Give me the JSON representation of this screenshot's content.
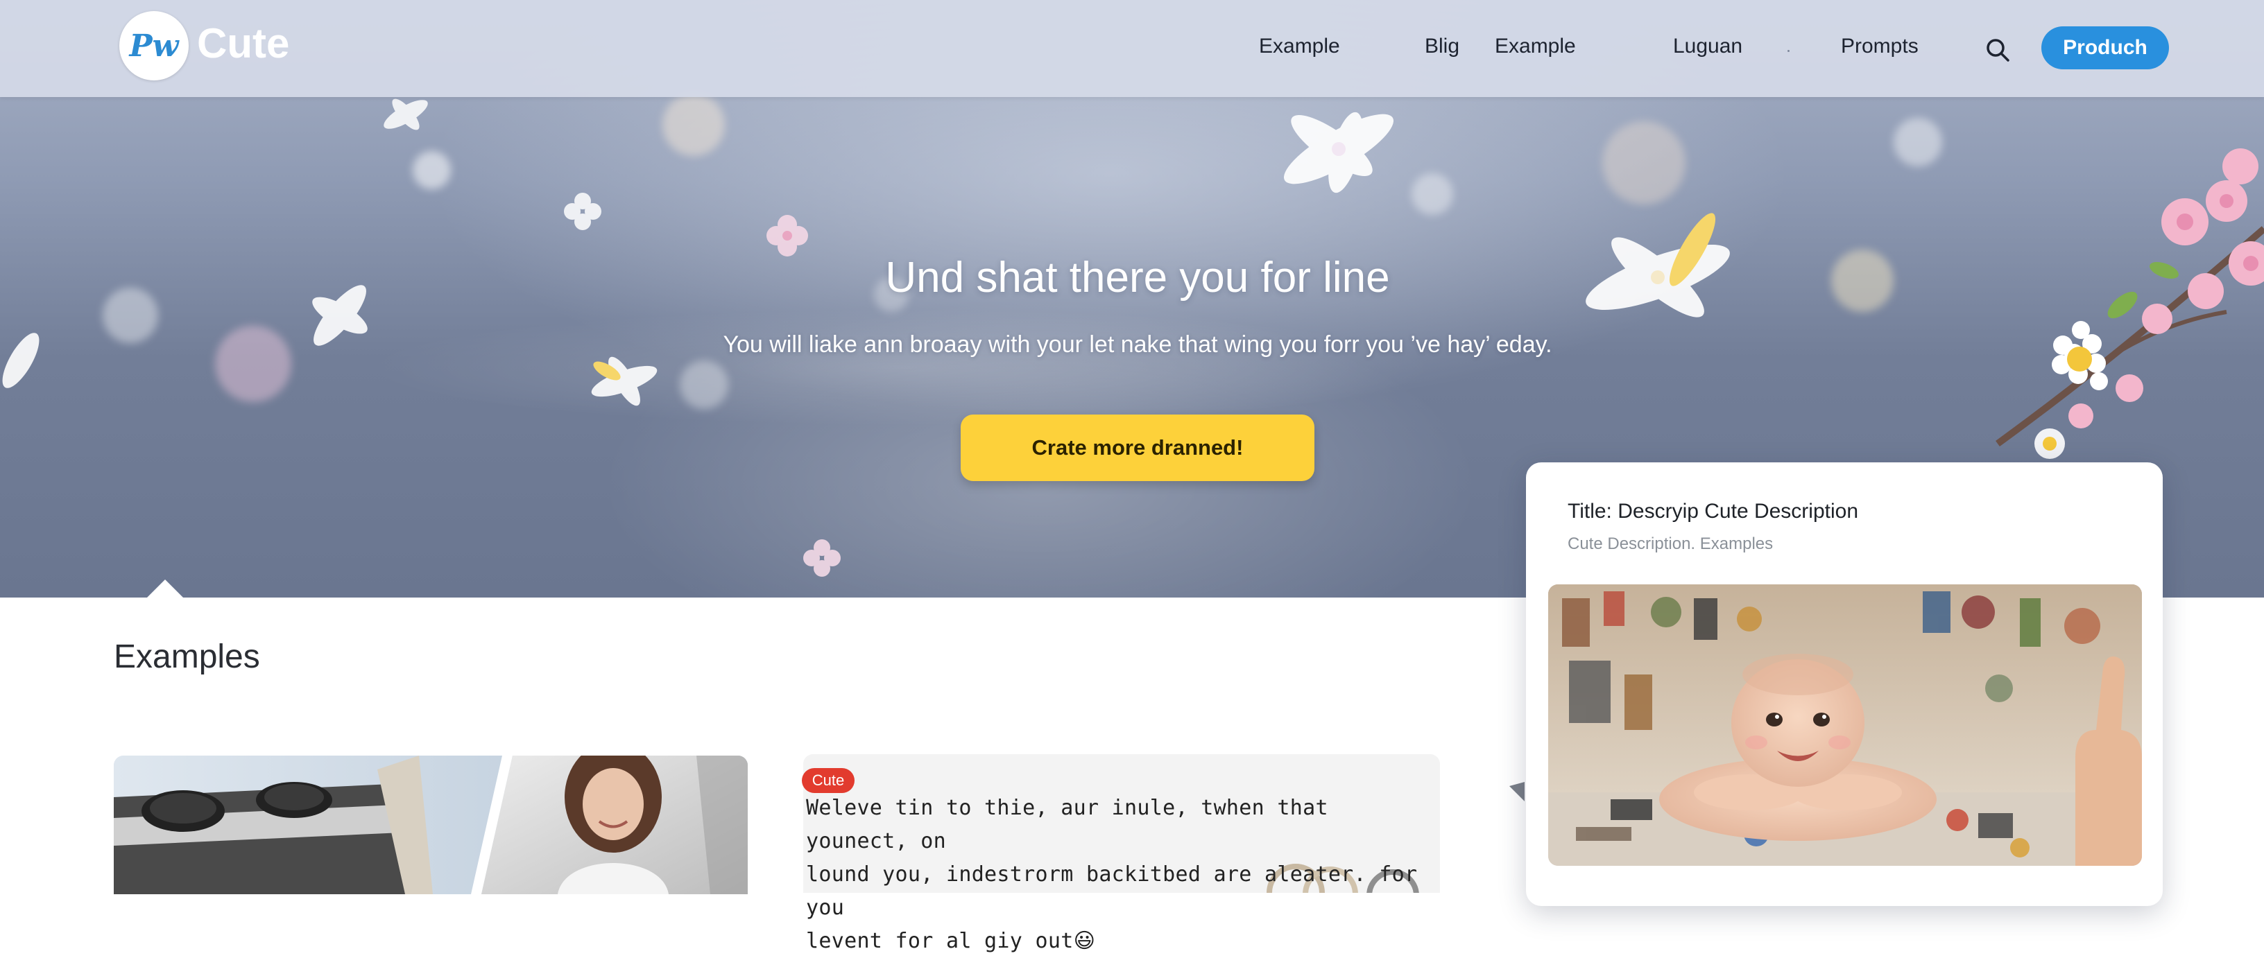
{
  "brand": {
    "logo_mark": "Pw",
    "name": "Cute"
  },
  "nav": {
    "links": [
      "Example",
      "Blig",
      "Example",
      "Luguan",
      "Prompts"
    ],
    "search_icon": "search-icon",
    "cta_label": "Produch"
  },
  "hero": {
    "title": "Und shat there you for line",
    "subtitle": "You will liake ann broaay with your let nake that wing you forr you ’ve hay’ eday.",
    "cta_label": "Crate more dranned!"
  },
  "examples": {
    "title": "Examples",
    "card2": {
      "tag": "Cute",
      "text_lines": [
        "Weleve tin to thie, aur inule, twhen that younect, on",
        "lound you, indestrorm backitbed are aleater. for you",
        "levent for al giy out"
      ],
      "emoji": "😃"
    }
  },
  "detail_card": {
    "title": "Title:  Descryip Cute Description",
    "subtitle": "Cute Description. Examples"
  },
  "colors": {
    "nav_bg": "#d5dae8",
    "accent_blue": "#2990de",
    "cta_yellow": "#fdd13a",
    "tag_red": "#e23b2e"
  }
}
